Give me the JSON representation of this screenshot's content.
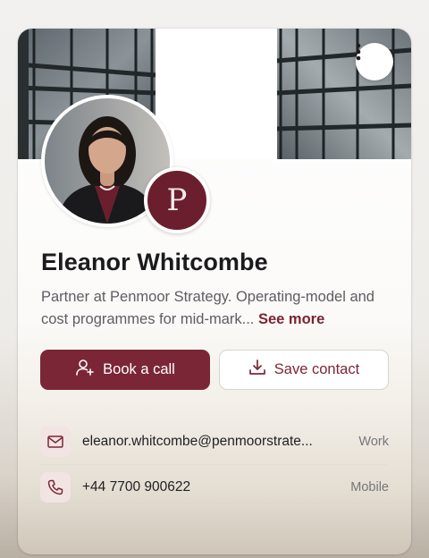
{
  "profile": {
    "name": "Eleanor Whitcombe",
    "bio": "Partner at Penmoor Strategy. Operating-model and cost programmes for mid-mark...",
    "see_more": "See more",
    "logo_letter": "P"
  },
  "actions": {
    "book_label": "Book a call",
    "save_label": "Save contact"
  },
  "contacts": [
    {
      "icon": "mail-icon",
      "value": "eleanor.whitcombe@penmoorstrate...",
      "tag": "Work"
    },
    {
      "icon": "phone-icon",
      "value": "+44 7700 900622",
      "tag": "Mobile"
    }
  ],
  "colors": {
    "accent": "#7b2637",
    "logo_bg": "#6b1f2e",
    "icon_bg": "#f1e4e3"
  },
  "icons": {
    "menu": "more-vertical-icon",
    "book": "user-plus-icon",
    "save": "download-icon"
  }
}
